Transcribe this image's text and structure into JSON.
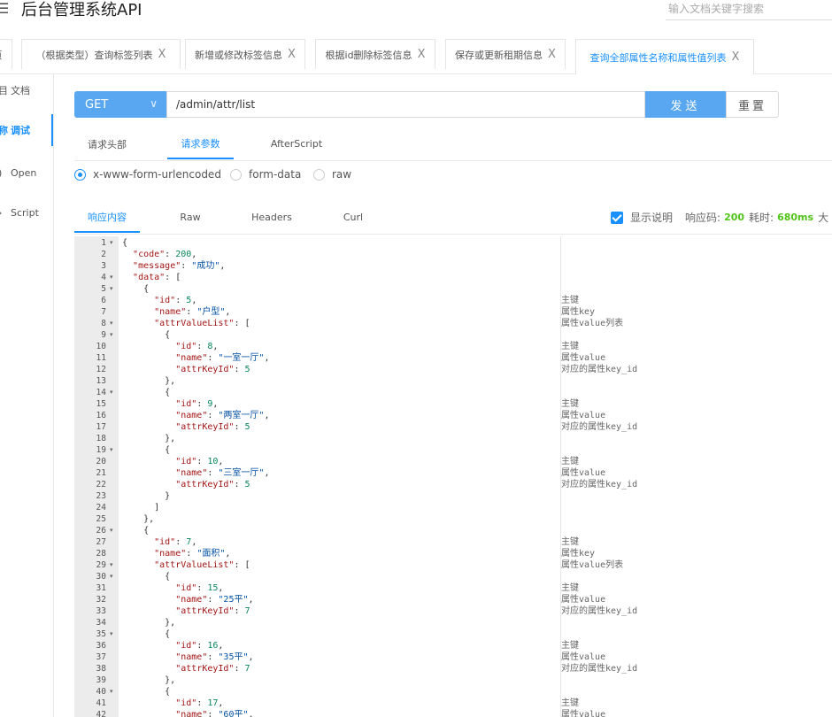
{
  "header": {
    "menu_icon": "menu-icon",
    "title": "后台管理系统API",
    "search_placeholder": "输入文档关键字搜索"
  },
  "tabs": [
    {
      "label": "页",
      "closable": false
    },
    {
      "label": "（根据类型）查询标签列表",
      "closable": true
    },
    {
      "label": "新增或修改标签信息",
      "closable": true
    },
    {
      "label": "根据id删除标签信息",
      "closable": true
    },
    {
      "label": "保存或更新租期信息",
      "closable": true
    },
    {
      "label": "查询全部属性名称和属性值列表",
      "closable": true,
      "active": true
    }
  ],
  "tab_close_glyph": "X",
  "sidebar": [
    {
      "icon": "目",
      "label": "文档"
    },
    {
      "icon": "称",
      "label": "调试",
      "active": true
    },
    {
      "icon": ")",
      "label": "Open"
    },
    {
      "icon": "›",
      "label": "Script"
    }
  ],
  "request": {
    "method": "GET",
    "url": "/admin/attr/list",
    "send_label": "发送",
    "reset_label": "重置"
  },
  "request_tabs": [
    "请求头部",
    "请求参数",
    "AfterScript"
  ],
  "request_tab_active": 1,
  "body_types": [
    {
      "label": "x-www-form-urlencoded",
      "checked": true
    },
    {
      "label": "form-data",
      "checked": false
    },
    {
      "label": "raw",
      "checked": false
    }
  ],
  "response_tabs": [
    "响应内容",
    "Raw",
    "Headers",
    "Curl"
  ],
  "response_tab_active": 0,
  "response_info": {
    "show_desc_label": "显示说明",
    "show_desc_checked": true,
    "status_label": "响应码:",
    "status_value": "200",
    "time_label": "耗时:",
    "time_value": "680ms",
    "size_label": "大"
  },
  "code_lines": [
    {
      "n": 1,
      "fold": true,
      "text": "{",
      "desc": ""
    },
    {
      "n": 2,
      "fold": false,
      "text": "  \"code\": 200,",
      "desc": ""
    },
    {
      "n": 3,
      "fold": false,
      "text": "  \"message\": \"成功\",",
      "desc": ""
    },
    {
      "n": 4,
      "fold": true,
      "text": "  \"data\": [",
      "desc": ""
    },
    {
      "n": 5,
      "fold": true,
      "text": "    {",
      "desc": ""
    },
    {
      "n": 6,
      "fold": false,
      "text": "      \"id\": 5,",
      "desc": "主键"
    },
    {
      "n": 7,
      "fold": false,
      "text": "      \"name\": \"户型\",",
      "desc": "属性key"
    },
    {
      "n": 8,
      "fold": true,
      "text": "      \"attrValueList\": [",
      "desc": "属性value列表"
    },
    {
      "n": 9,
      "fold": true,
      "text": "        {",
      "desc": ""
    },
    {
      "n": 10,
      "fold": false,
      "text": "          \"id\": 8,",
      "desc": "主键"
    },
    {
      "n": 11,
      "fold": false,
      "text": "          \"name\": \"一室一厅\",",
      "desc": "属性value"
    },
    {
      "n": 12,
      "fold": false,
      "text": "          \"attrKeyId\": 5",
      "desc": "对应的属性key_id"
    },
    {
      "n": 13,
      "fold": false,
      "text": "        },",
      "desc": ""
    },
    {
      "n": 14,
      "fold": true,
      "text": "        {",
      "desc": ""
    },
    {
      "n": 15,
      "fold": false,
      "text": "          \"id\": 9,",
      "desc": "主键"
    },
    {
      "n": 16,
      "fold": false,
      "text": "          \"name\": \"两室一厅\",",
      "desc": "属性value"
    },
    {
      "n": 17,
      "fold": false,
      "text": "          \"attrKeyId\": 5",
      "desc": "对应的属性key_id"
    },
    {
      "n": 18,
      "fold": false,
      "text": "        },",
      "desc": ""
    },
    {
      "n": 19,
      "fold": true,
      "text": "        {",
      "desc": ""
    },
    {
      "n": 20,
      "fold": false,
      "text": "          \"id\": 10,",
      "desc": "主键"
    },
    {
      "n": 21,
      "fold": false,
      "text": "          \"name\": \"三室一厅\",",
      "desc": "属性value"
    },
    {
      "n": 22,
      "fold": false,
      "text": "          \"attrKeyId\": 5",
      "desc": "对应的属性key_id"
    },
    {
      "n": 23,
      "fold": false,
      "text": "        }",
      "desc": ""
    },
    {
      "n": 24,
      "fold": false,
      "text": "      ]",
      "desc": ""
    },
    {
      "n": 25,
      "fold": false,
      "text": "    },",
      "desc": ""
    },
    {
      "n": 26,
      "fold": true,
      "text": "    {",
      "desc": ""
    },
    {
      "n": 27,
      "fold": false,
      "text": "      \"id\": 7,",
      "desc": "主键"
    },
    {
      "n": 28,
      "fold": false,
      "text": "      \"name\": \"面积\",",
      "desc": "属性key"
    },
    {
      "n": 29,
      "fold": true,
      "text": "      \"attrValueList\": [",
      "desc": "属性value列表"
    },
    {
      "n": 30,
      "fold": true,
      "text": "        {",
      "desc": ""
    },
    {
      "n": 31,
      "fold": false,
      "text": "          \"id\": 15,",
      "desc": "主键"
    },
    {
      "n": 32,
      "fold": false,
      "text": "          \"name\": \"25平\",",
      "desc": "属性value"
    },
    {
      "n": 33,
      "fold": false,
      "text": "          \"attrKeyId\": 7",
      "desc": "对应的属性key_id"
    },
    {
      "n": 34,
      "fold": false,
      "text": "        },",
      "desc": ""
    },
    {
      "n": 35,
      "fold": true,
      "text": "        {",
      "desc": ""
    },
    {
      "n": 36,
      "fold": false,
      "text": "          \"id\": 16,",
      "desc": "主键"
    },
    {
      "n": 37,
      "fold": false,
      "text": "          \"name\": \"35平\",",
      "desc": "属性value"
    },
    {
      "n": 38,
      "fold": false,
      "text": "          \"attrKeyId\": 7",
      "desc": "对应的属性key_id"
    },
    {
      "n": 39,
      "fold": false,
      "text": "        },",
      "desc": ""
    },
    {
      "n": 40,
      "fold": true,
      "text": "        {",
      "desc": ""
    },
    {
      "n": 41,
      "fold": false,
      "text": "          \"id\": 17,",
      "desc": "主键"
    },
    {
      "n": 42,
      "fold": false,
      "text": "          \"name\": \"60平\",",
      "desc": "属性value"
    }
  ],
  "colors": {
    "accent": "#1890ff",
    "button": "#58a7f0",
    "status_green": "#52c41a",
    "json_key": "#a31515",
    "json_string": "#0451a5",
    "json_number": "#098658"
  }
}
